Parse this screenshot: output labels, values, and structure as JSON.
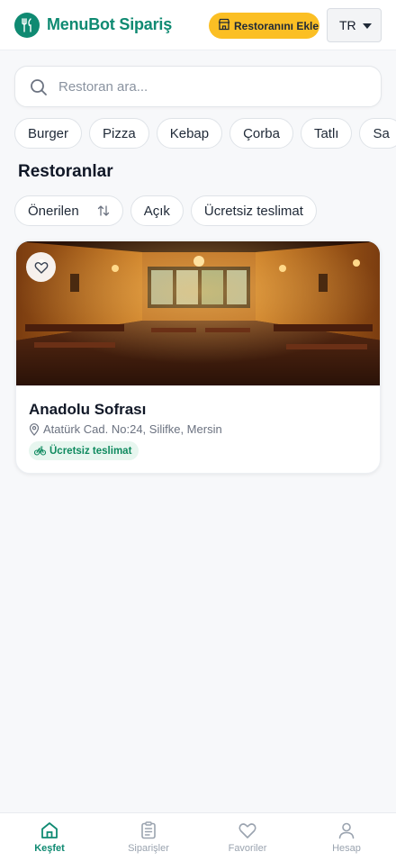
{
  "header": {
    "app_title": "MenuBot Sipariş",
    "add_restaurant_label": "Restoranını Ekle",
    "language": "TR"
  },
  "search": {
    "placeholder": "Restoran ara..."
  },
  "categories": [
    "Burger",
    "Pizza",
    "Kebap",
    "Çorba",
    "Tatlı",
    "Sa"
  ],
  "section_title": "Restoranlar",
  "filters": {
    "sort_label": "Önerilen",
    "open_label": "Açık",
    "free_delivery_label": "Ücretsiz teslimat"
  },
  "restaurant": {
    "name": "Anadolu Sofrası",
    "address": "Atatürk Cad. No:24, Silifke, Mersin",
    "badge": "Ücretsiz teslimat"
  },
  "bottom_nav": {
    "explore": "Keşfet",
    "orders": "Siparişler",
    "favorites": "Favoriler",
    "account": "Hesap"
  },
  "colors": {
    "brand": "#0f8a72",
    "accent": "#fbbf24",
    "badge_bg": "#e7f6ef",
    "badge_text": "#0f8a5f"
  },
  "icons": [
    "utensils-icon",
    "store-icon",
    "chevron-down-icon",
    "search-icon",
    "sort-icon",
    "heart-icon",
    "map-pin-icon",
    "bike-icon",
    "home-icon",
    "clipboard-icon",
    "user-icon"
  ]
}
